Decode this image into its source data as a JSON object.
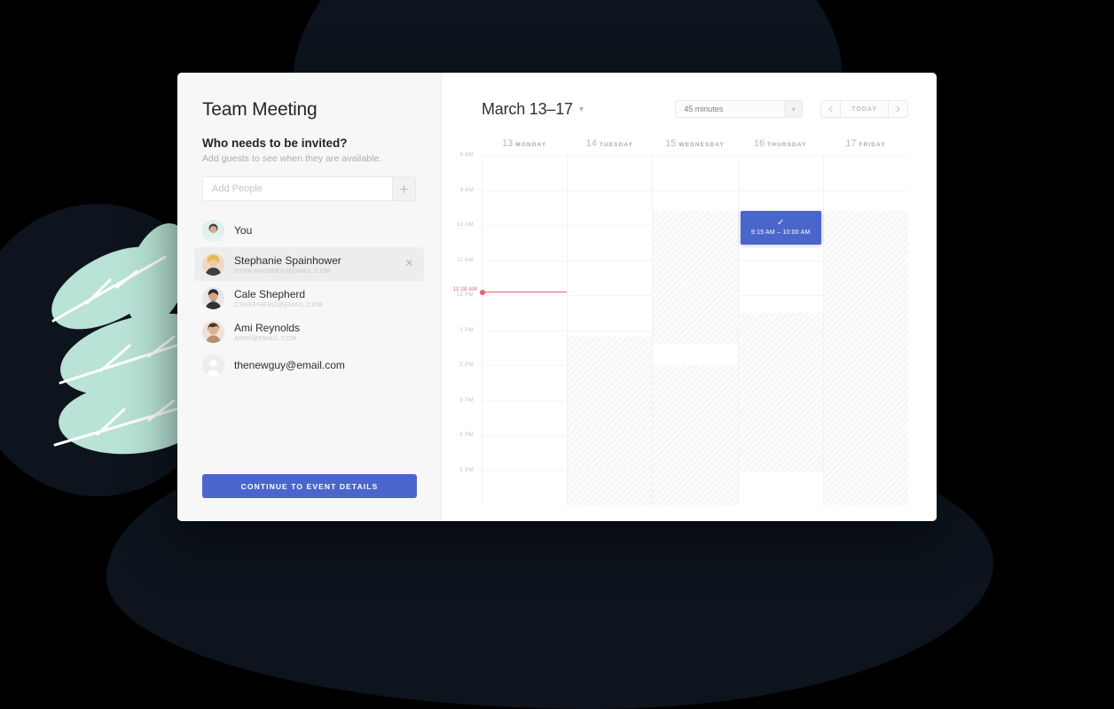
{
  "panel": {
    "title": "Team Meeting",
    "question": "Who needs to be invited?",
    "subtitle": "Add guests to see when they are available.",
    "search_placeholder": "Add People",
    "search_value": "",
    "add_icon": "plus-icon",
    "cta_label": "CONTINUE TO EVENT DETAILS",
    "people": [
      {
        "name": "You",
        "email": "",
        "selected": false,
        "removable": false,
        "avatar": "photo"
      },
      {
        "name": "Stephanie Spainhower",
        "email": "SSPAINHOWER@EMAIL.COM",
        "selected": true,
        "removable": true,
        "avatar": "photo"
      },
      {
        "name": "Cale Shepherd",
        "email": "CSHEPHERD@EMAIL.COM",
        "selected": false,
        "removable": false,
        "avatar": "photo"
      },
      {
        "name": "Ami Reynolds",
        "email": "AMIR@EMAIL.COM",
        "selected": false,
        "removable": false,
        "avatar": "photo"
      },
      {
        "name": "thenewguy@email.com",
        "email": "",
        "selected": false,
        "removable": false,
        "avatar": "placeholder"
      }
    ]
  },
  "calendar": {
    "range_title": "March 13–17",
    "range_chevron": "chevron-down-icon",
    "duration_value": "45 minutes",
    "duration_chevron": "chevron-down-icon",
    "nav": {
      "prev_icon": "chevron-left-icon",
      "today_label": "TODAY",
      "next_icon": "chevron-right-icon"
    },
    "days": [
      {
        "num": "13",
        "name": "MONDAY"
      },
      {
        "num": "14",
        "name": "TUESDAY"
      },
      {
        "num": "15",
        "name": "WEDNESDAY"
      },
      {
        "num": "16",
        "name": "THURSDAY"
      },
      {
        "num": "17",
        "name": "FRIDAY"
      }
    ],
    "times": [
      "8 AM",
      "9 AM",
      "10 AM",
      "11 AM",
      "12 PM",
      "1 PM",
      "2 PM",
      "3 PM",
      "4 PM",
      "5 PM"
    ],
    "now": {
      "label": "11:28 AM",
      "day_index": 0,
      "offset_pct": 39.0,
      "color": "#e4606d"
    },
    "event": {
      "day_index": 3,
      "time_label": "9:15 AM – 10:00 AM",
      "check_icon": "check-icon",
      "top_pct": 16.0,
      "height_pct": 9.5,
      "color": "#4a66cc"
    },
    "busy_blocks": [
      {
        "day_index": 1,
        "top_pct": 52.0,
        "height_pct": 48.0
      },
      {
        "day_index": 1,
        "top_pct": 78.0,
        "height_pct": 12.0
      },
      {
        "day_index": 2,
        "top_pct": 16.0,
        "height_pct": 38.0
      },
      {
        "day_index": 2,
        "top_pct": 60.0,
        "height_pct": 40.0
      },
      {
        "day_index": 3,
        "top_pct": 16.0,
        "height_pct": 9.5
      },
      {
        "day_index": 3,
        "top_pct": 45.0,
        "height_pct": 45.0
      },
      {
        "day_index": 4,
        "top_pct": 16.0,
        "height_pct": 84.0
      }
    ],
    "colors": {
      "accent": "#4a66cc",
      "busy_bg": "#f6f6f7",
      "grid_line": "#f4f5f6"
    }
  },
  "decor": {
    "plant_color": "#b9e3d7",
    "plant_vein_color": "#ffffff",
    "blob_color": "#0d141d",
    "background_color": "#000000"
  }
}
